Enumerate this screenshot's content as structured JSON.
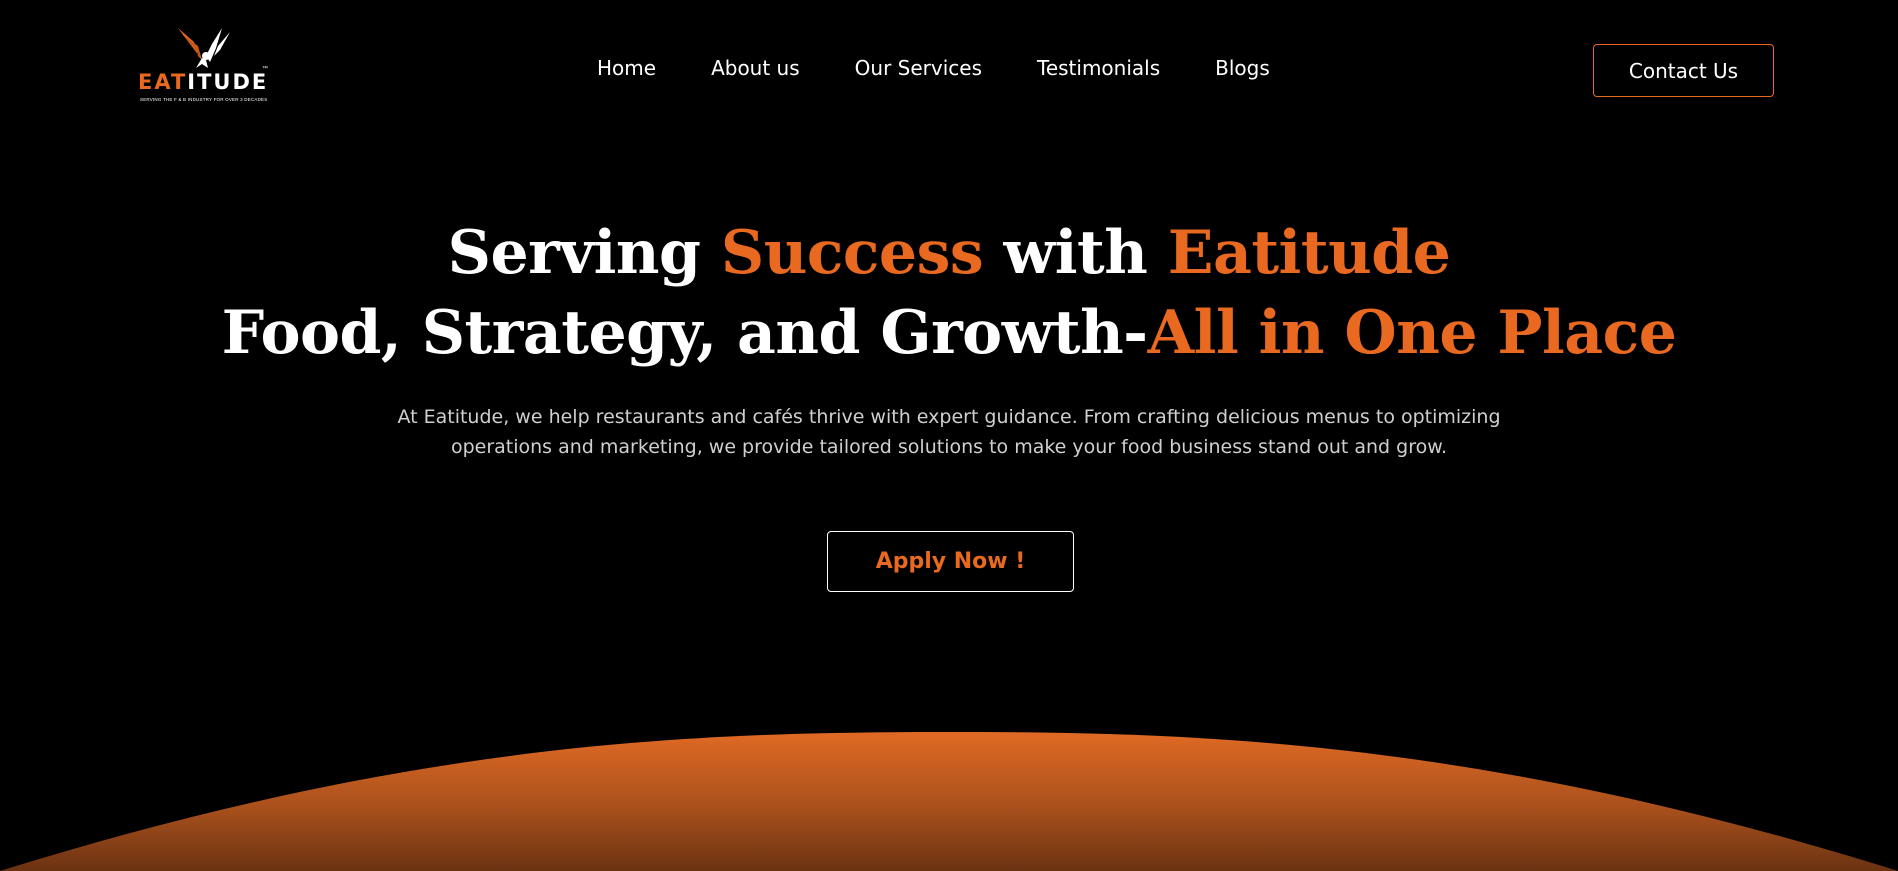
{
  "brand": {
    "name_accent": "EAT",
    "name_rest": "ITUDE",
    "tagline": "SERVING THE F & B INDUSTRY FOR OVER 3 DECADES",
    "trademark": "™",
    "accent_color": "#e8691f"
  },
  "nav": {
    "items": [
      {
        "label": "Home"
      },
      {
        "label": "About us"
      },
      {
        "label": "Our Services"
      },
      {
        "label": "Testimonials"
      },
      {
        "label": "Blogs"
      }
    ],
    "contact_label": "Contact Us"
  },
  "hero": {
    "line1_a": "Serving ",
    "line1_b": "Success",
    "line1_c": " with ",
    "line1_d": "Eatitude",
    "line2_a": "Food, Strategy, and Growth-",
    "line2_b": "All in One Place",
    "subtitle": "At Eatitude, we help restaurants and cafés thrive with expert guidance. From crafting delicious menus to optimizing operations and marketing, we provide tailored solutions to make your food business stand out and grow.",
    "cta_label": "Apply Now !"
  },
  "icons": {
    "logo": "bird-logo-icon"
  }
}
